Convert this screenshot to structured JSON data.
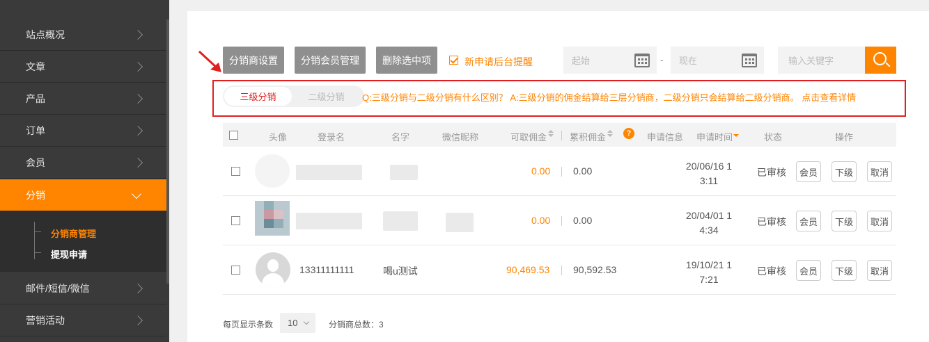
{
  "sidebar": {
    "items": [
      {
        "label": "站点概况"
      },
      {
        "label": "文章"
      },
      {
        "label": "产品"
      },
      {
        "label": "订单"
      },
      {
        "label": "会员"
      },
      {
        "label": "分销"
      },
      {
        "label": "邮件/短信/微信"
      },
      {
        "label": "营销活动"
      }
    ],
    "submenu": [
      {
        "label": "分销商管理"
      },
      {
        "label": "提现申请"
      }
    ]
  },
  "toolbar": {
    "distributor_settings": "分销商设置",
    "member_management": "分销会员管理",
    "delete_selected": "删除选中项",
    "remind_label": "新申请后台提醒",
    "remind_checked": true,
    "date_start_placeholder": "起始",
    "date_end_placeholder": "现在",
    "date_separator": "-",
    "search_placeholder": "输入关键字"
  },
  "level_tabs": {
    "active": "三级分销",
    "inactive": "二级分销",
    "faq": "Q:三级分销与二级分销有什么区别？ A:三级分销的佣金结算给三层分销商，二级分销只会结算给二级分销商。 点击查看详情"
  },
  "table": {
    "headers": {
      "avatar": "头像",
      "login": "登录名",
      "name": "名字",
      "wechat": "微信昵称",
      "available": "可取佣金",
      "cumulative": "累积佣金",
      "help": "?",
      "apply_info": "申请信息",
      "apply_time": "申请时间",
      "status": "状态",
      "ops": "操作"
    },
    "rows": [
      {
        "login": "",
        "name": "",
        "wechat": "",
        "available": "0.00",
        "cumulative": "0.00",
        "time": "20/06/16 13:11",
        "status": "已审核",
        "op_member": "会员",
        "op_sub": "下级",
        "op_cancel": "取消"
      },
      {
        "login": "",
        "name": "",
        "wechat": "",
        "available": "0.00",
        "cumulative": "0.00",
        "time": "20/04/01 14:34",
        "status": "已审核",
        "op_member": "会员",
        "op_sub": "下级",
        "op_cancel": "取消"
      },
      {
        "login": "13311111111",
        "name": "喝u测试",
        "wechat": "",
        "available": "90,469.53",
        "cumulative": "90,592.53",
        "time": "19/10/21 17:21",
        "status": "已审核",
        "op_member": "会员",
        "op_sub": "下级",
        "op_cancel": "取消"
      }
    ]
  },
  "footer": {
    "per_page_label": "每页显示条数",
    "per_page_value": "10",
    "total_label": "分销商总数：3"
  },
  "colors": {
    "accent": "#ff8400",
    "highlight_box": "#e02020",
    "sidebar_bg": "#3a3a3a"
  }
}
